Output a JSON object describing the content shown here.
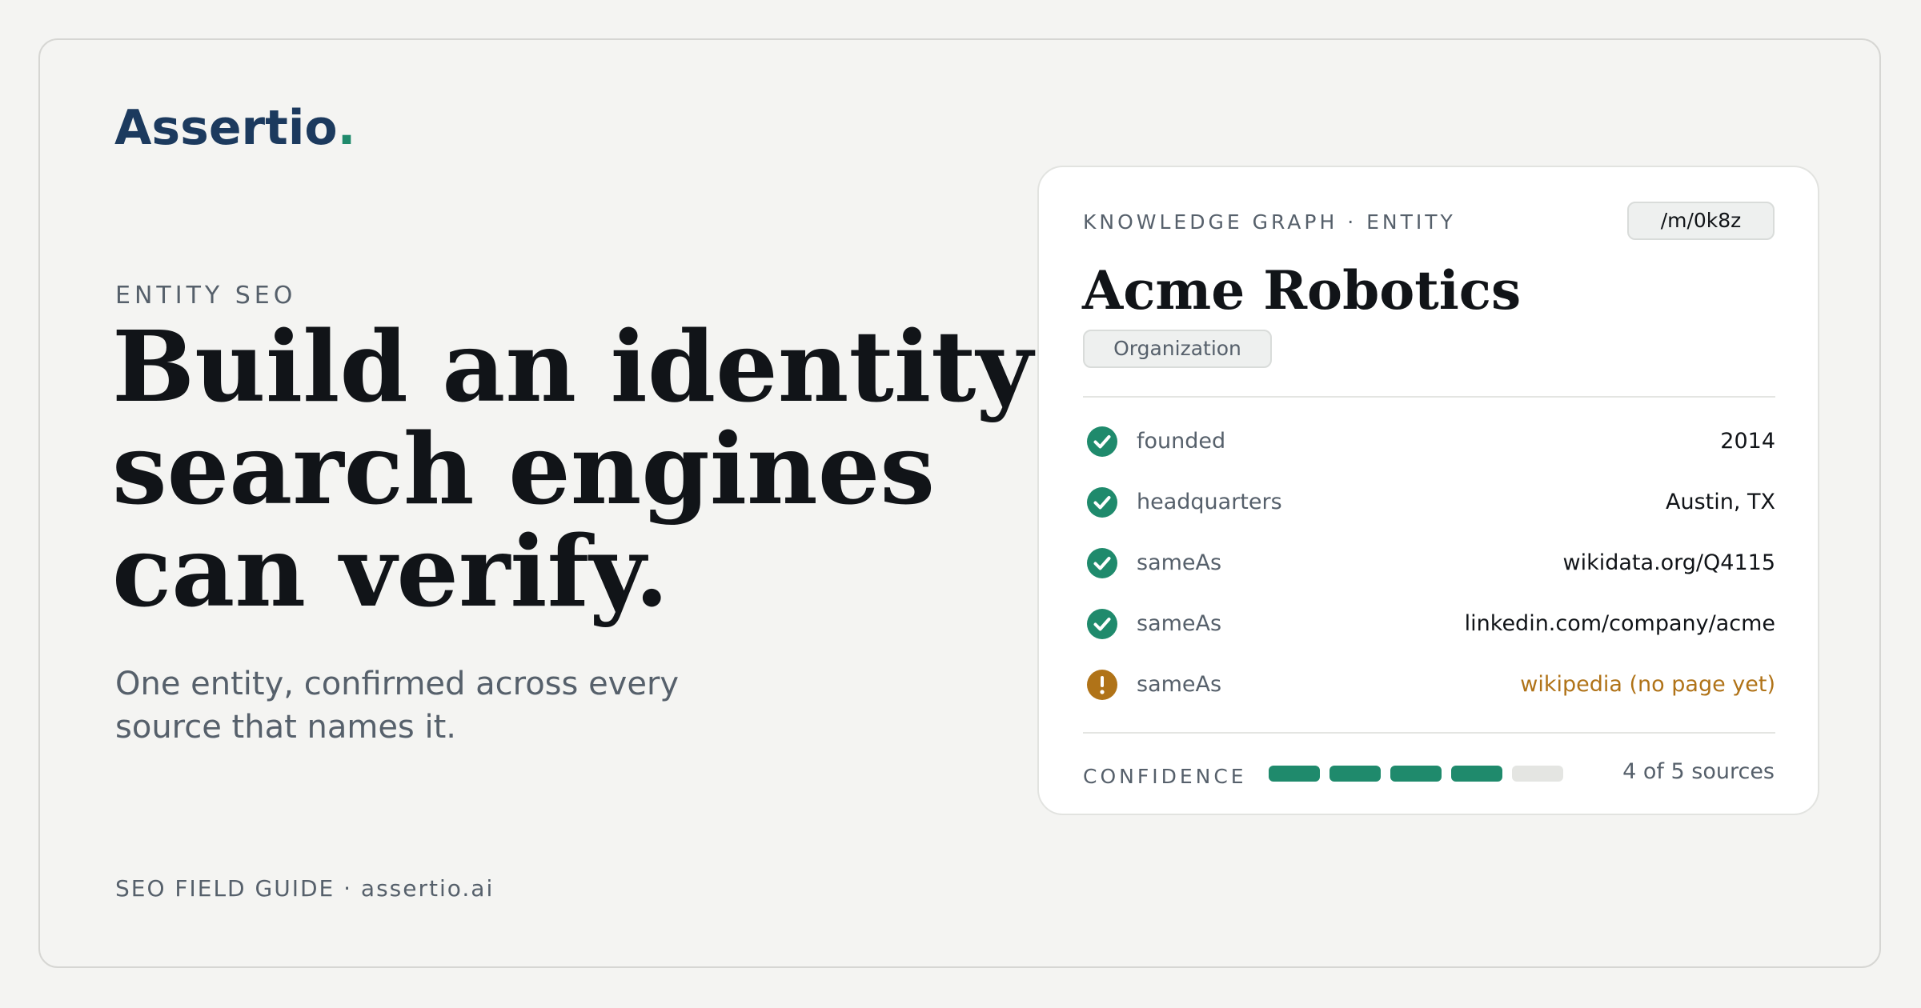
{
  "brand": {
    "name": "Assertio",
    "dot": ".",
    "colors": {
      "navy": "#1c3a5e",
      "green": "#1f8a6c",
      "amber": "#b07318"
    }
  },
  "hero": {
    "eyebrow": "ENTITY SEO",
    "headline": "Build an identity search engines can verify.",
    "subtext": "One entity, confirmed across every source that names it."
  },
  "footer": {
    "text": "SEO FIELD GUIDE · assertio.ai"
  },
  "card": {
    "kicker": "KNOWLEDGE GRAPH · ENTITY",
    "entity_id": "/m/0k8z",
    "entity_name": "Acme Robotics",
    "entity_type": "Organization",
    "facts": [
      {
        "key": "founded",
        "value": "2014",
        "status": "verified",
        "icon": "check-circle-icon"
      },
      {
        "key": "headquarters",
        "value": "Austin, TX",
        "status": "verified",
        "icon": "check-circle-icon"
      },
      {
        "key": "sameAs",
        "value": "wikidata.org/Q4115",
        "status": "verified",
        "icon": "check-circle-icon"
      },
      {
        "key": "sameAs",
        "value": "linkedin.com/company/acme",
        "status": "verified",
        "icon": "check-circle-icon"
      },
      {
        "key": "sameAs",
        "value": "wikipedia (no page yet)",
        "status": "warning",
        "icon": "exclamation-circle-icon"
      }
    ],
    "confidence": {
      "label": "CONFIDENCE",
      "filled": 4,
      "total": 5,
      "text": "4 of 5 sources"
    }
  }
}
